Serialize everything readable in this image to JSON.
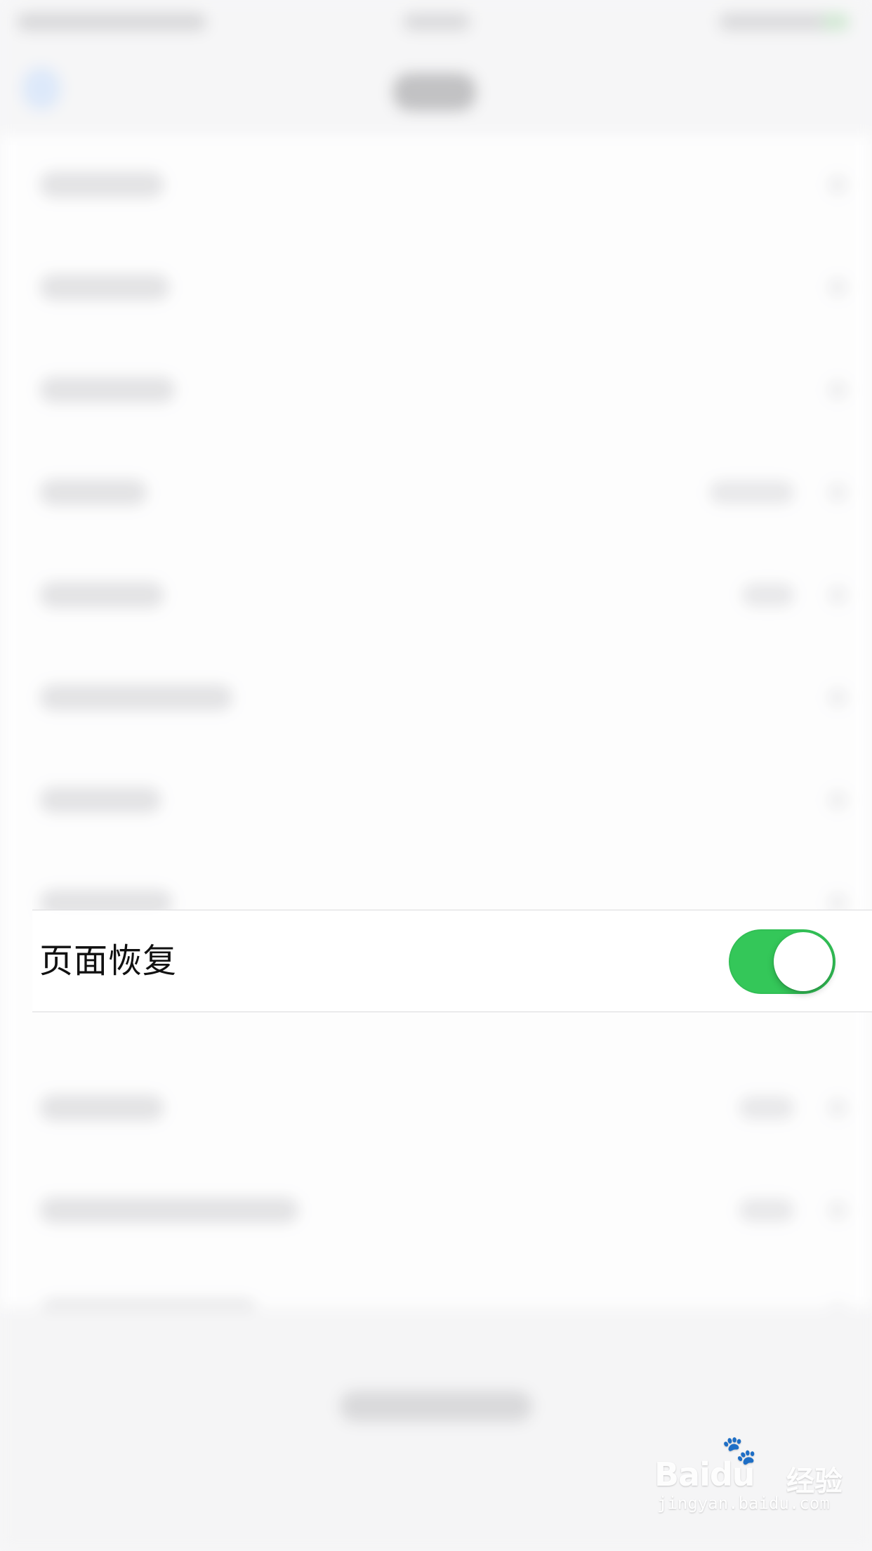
{
  "setting": {
    "label": "页面恢复",
    "toggle_state": "on"
  },
  "watermark": {
    "brand": "Baidu",
    "jingyan": "经验",
    "url": "jingyan.baidu.com",
    "paw_icon": "paw-icon"
  },
  "colors": {
    "toggle_on": "#34c759",
    "knob": "#ffffff",
    "row_background": "#ffffff",
    "page_background": "#f7f7f8"
  }
}
